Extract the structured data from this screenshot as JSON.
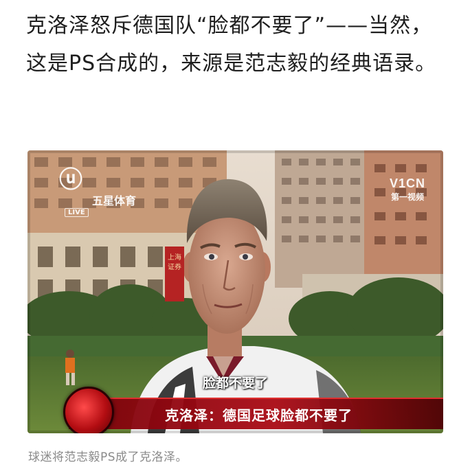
{
  "post": {
    "text": "克洛泽怒斥德国队“脸都不要了”——当然，这是PS合成的，来源是范志毅的经典语录。"
  },
  "image": {
    "subtitle": "脸都不要了",
    "lower_third": "克洛泽：德国足球脸都不要了",
    "logo_left_name": "五星体育",
    "logo_left_live": "LIVE",
    "logo_right_name": "V1CN",
    "logo_right_sub": "第一视频",
    "sign_text": "上海证券"
  },
  "caption": "球迷将范志毅PS成了克洛泽。",
  "colors": {
    "text": "#1f1f1f",
    "caption": "#8a8a8a",
    "lower_third": "#a80a14"
  }
}
